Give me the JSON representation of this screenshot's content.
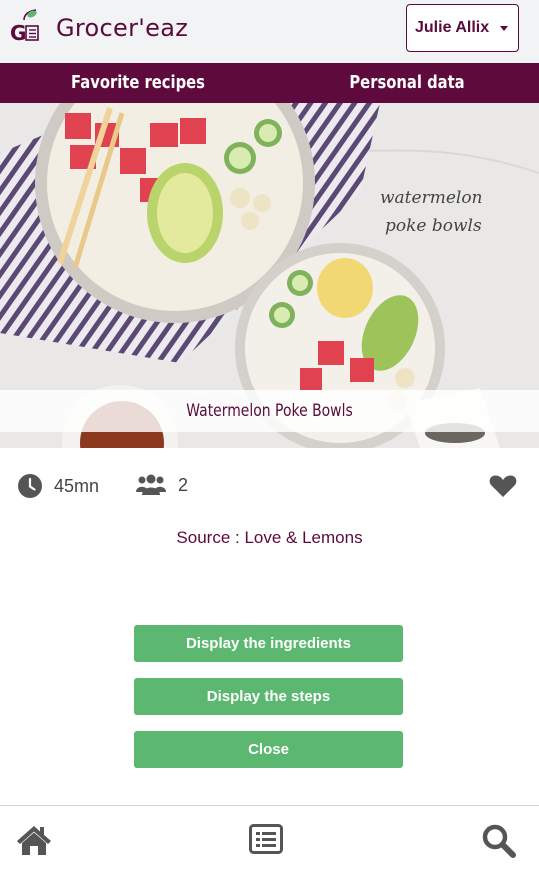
{
  "app": {
    "brand": "Grocer'eaz",
    "logo_text": "G",
    "user_menu_label": "Julie Allix"
  },
  "nav": {
    "favorite_label": "Favorite recipes",
    "personal_label": "Personal data"
  },
  "recipe": {
    "title": "Watermelon Poke Bowls",
    "image_caption_line1": "watermelon",
    "image_caption_line2": "poke bowls",
    "duration": "45mn",
    "servings": "2",
    "source": "Source : Love & Lemons",
    "favorite": false
  },
  "actions": {
    "ingredients_label": "Display the ingredients",
    "steps_label": "Display the steps",
    "close_label": "Close"
  },
  "footer": {
    "icons": [
      "home-icon",
      "list-icon",
      "search-icon"
    ]
  },
  "colors": {
    "brand": "#5a0b3c",
    "nav_bg": "#5e0a3d",
    "button": "#5cb770",
    "header_bg": "#f1f3f5",
    "icon_grey": "#555555"
  }
}
